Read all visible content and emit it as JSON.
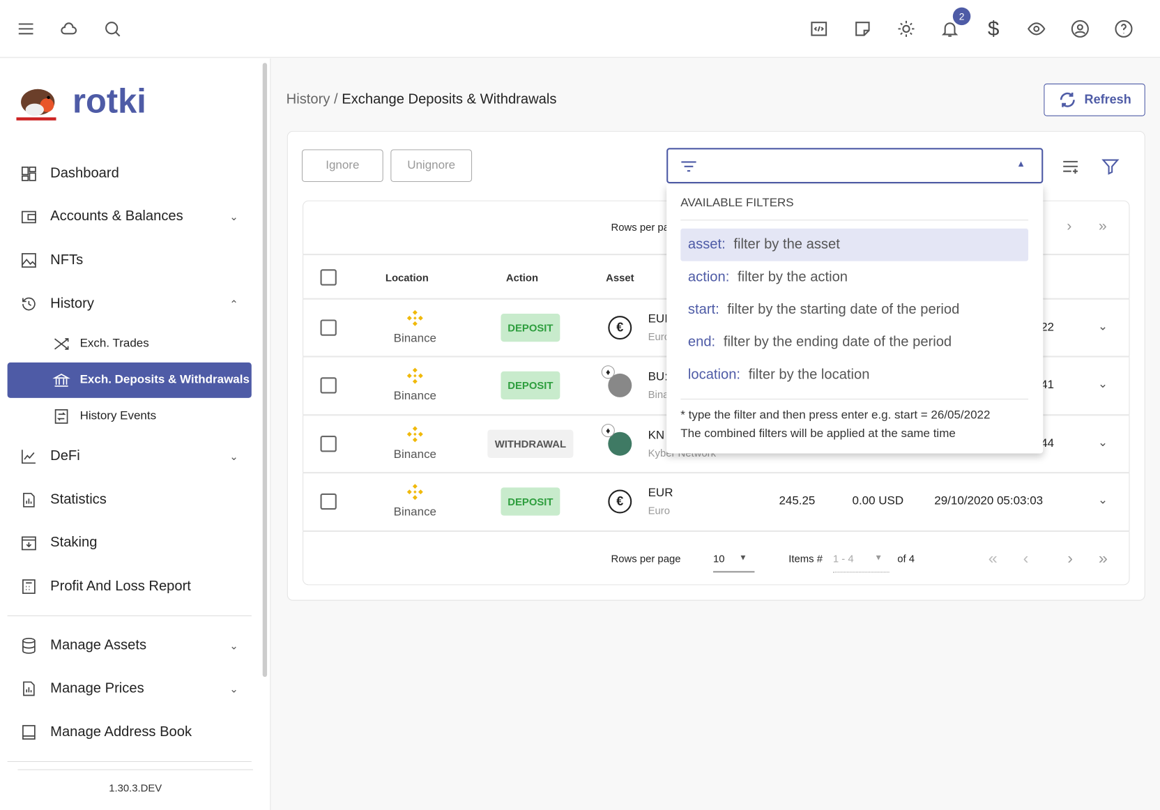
{
  "topbar": {
    "icons": [
      "menu-icon",
      "cloud-icon",
      "search-icon",
      "code-icon",
      "notes-icon",
      "theme-icon",
      "bell-icon",
      "dollar-icon",
      "eye-icon",
      "account-icon",
      "help-icon"
    ],
    "notification_count": "2"
  },
  "brand": {
    "name": "rotki",
    "accent": "#4e5ba6"
  },
  "sidebar": {
    "items": [
      {
        "label": "Dashboard"
      },
      {
        "label": "Accounts & Balances"
      },
      {
        "label": "NFTs"
      },
      {
        "label": "History"
      },
      {
        "label": "Exch. Trades"
      },
      {
        "label": "Exch. Deposits & Withdrawals"
      },
      {
        "label": "History Events"
      },
      {
        "label": "DeFi"
      },
      {
        "label": "Statistics"
      },
      {
        "label": "Staking"
      },
      {
        "label": "Profit And Loss Report"
      },
      {
        "label": "Manage Assets"
      },
      {
        "label": "Manage Prices"
      },
      {
        "label": "Manage Address Book"
      }
    ],
    "version": "1.30.3.DEV"
  },
  "breadcrumb": {
    "parent": "History /",
    "current": "Exchange Deposits & Withdrawals"
  },
  "actions": {
    "refresh": "Refresh",
    "ignore": "Ignore",
    "unignore": "Unignore"
  },
  "table": {
    "headers": {
      "location": "Location",
      "action": "Action",
      "asset": "Asset"
    },
    "top_rows_per_page": "Rows per pa",
    "rows": [
      {
        "location": "Binance",
        "action": "DEPOSIT",
        "symbol": "EUI",
        "name": "Eurc",
        "tail": "22"
      },
      {
        "location": "Binance",
        "action": "DEPOSIT",
        "symbol": "BU:",
        "name": "Bina",
        "tail": "41"
      },
      {
        "location": "Binance",
        "action": "WITHDRAWAL",
        "symbol": "KN",
        "name": "Kyber Network",
        "tail": "44"
      },
      {
        "location": "Binance",
        "action": "DEPOSIT",
        "symbol": "EUR",
        "name": "Euro",
        "amount": "245.25",
        "value": "0.00 USD",
        "datetime": "29/10/2020 05:03:03"
      }
    ],
    "footer": {
      "rows_per_page": "Rows per page",
      "rows_value": "10",
      "items_label": "Items #",
      "items_range": "1 - 4",
      "of": "of 4"
    }
  },
  "filter_menu": {
    "heading": "AVAILABLE FILTERS",
    "options": [
      {
        "key": "asset:",
        "desc": "filter by the asset"
      },
      {
        "key": "action:",
        "desc": "filter by the action"
      },
      {
        "key": "start:",
        "desc": "filter by the starting date of the period"
      },
      {
        "key": "end:",
        "desc": "filter by the ending date of the period"
      },
      {
        "key": "location:",
        "desc": "filter by the location"
      }
    ],
    "note1": "* type the filter and then press enter e.g. start = 26/05/2022",
    "note2": "The combined filters will be applied at the same time"
  }
}
